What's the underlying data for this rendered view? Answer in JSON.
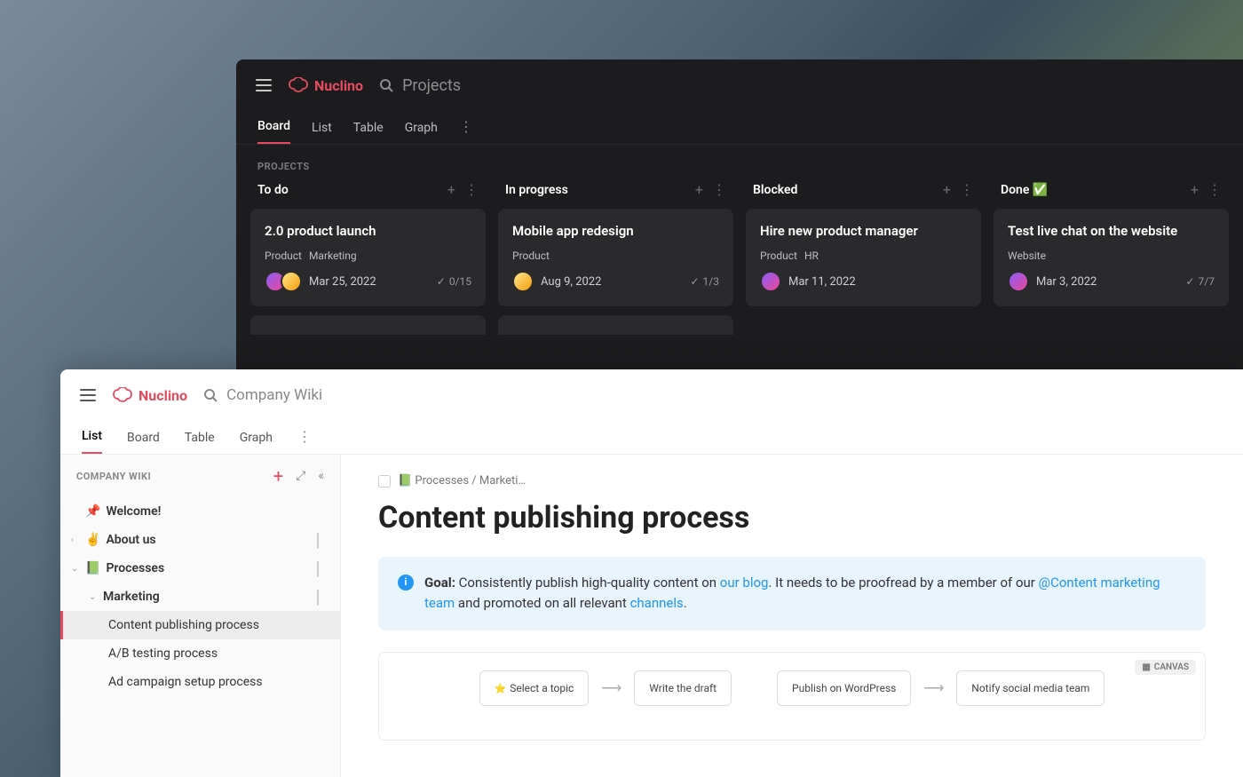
{
  "brand": "Nuclino",
  "darkWindow": {
    "searchPlaceholder": "Projects",
    "tabs": [
      "Board",
      "List",
      "Table",
      "Graph"
    ],
    "activeTab": "Board",
    "sectionLabel": "PROJECTS",
    "columns": [
      {
        "title": "To do",
        "card": {
          "title": "2.0 product launch",
          "tags": [
            "Product",
            "Marketing"
          ],
          "avatars": 2,
          "date": "Mar 25, 2022",
          "progress": "0/15"
        }
      },
      {
        "title": "In progress",
        "card": {
          "title": "Mobile app redesign",
          "tags": [
            "Product"
          ],
          "avatars": 1,
          "date": "Aug 9, 2022",
          "progress": "1/3"
        }
      },
      {
        "title": "Blocked",
        "card": {
          "title": "Hire new product manager",
          "tags": [
            "Product",
            "HR"
          ],
          "avatars": 1,
          "date": "Mar 11, 2022",
          "progress": ""
        }
      },
      {
        "title": "Done ✅",
        "card": {
          "title": "Test live chat on the website",
          "tags": [
            "Website"
          ],
          "avatars": 1,
          "date": "Mar 3, 2022",
          "progress": "7/7"
        }
      }
    ]
  },
  "lightWindow": {
    "searchPlaceholder": "Company Wiki",
    "tabs": [
      "List",
      "Board",
      "Table",
      "Graph"
    ],
    "activeTab": "List",
    "sidebarTitle": "COMPANY WIKI",
    "tree": {
      "welcome": "Welcome!",
      "about": "About us",
      "processes": "Processes",
      "marketing": "Marketing",
      "items": [
        "Content publishing process",
        "A/B testing process",
        "Ad campaign setup process"
      ]
    },
    "breadcrumb": "📗 Processes / Marketi…",
    "pageTitle": "Content publishing process",
    "callout": {
      "label": "Goal:",
      "t1": " Consistently publish high-quality content on ",
      "link1": "our blog",
      "t2": ". It needs to be proofread by a member of our ",
      "mention": "@Content marketing team",
      "t3": " and promoted on all relevant ",
      "link2": "channels",
      "t4": "."
    },
    "canvas": {
      "badge": "CANVAS",
      "nodes": [
        "Select a topic",
        "Write the draft",
        "Publish on WordPress",
        "Notify social media team"
      ]
    }
  }
}
